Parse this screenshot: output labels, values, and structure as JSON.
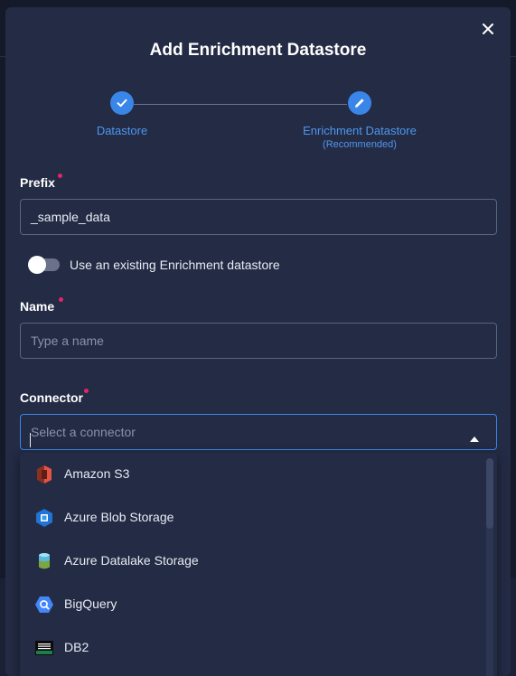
{
  "modal": {
    "title": "Add Enrichment Datastore",
    "close_icon": "close-icon"
  },
  "stepper": {
    "steps": [
      {
        "label": "Datastore",
        "sublabel": "",
        "icon": "check-icon",
        "state": "completed"
      },
      {
        "label": "Enrichment Datastore",
        "sublabel": "(Recommended)",
        "icon": "pencil-icon",
        "state": "active"
      }
    ]
  },
  "form": {
    "prefix": {
      "label": "Prefix",
      "required": true,
      "value": "_sample_data"
    },
    "toggle": {
      "label": "Use an existing Enrichment datastore",
      "checked": false
    },
    "name": {
      "label": "Name",
      "required": true,
      "value": "",
      "placeholder": "Type a name"
    },
    "connector": {
      "label": "Connector",
      "required": true,
      "value": "",
      "placeholder": "Select a connector"
    }
  },
  "connector_options": [
    {
      "label": "Amazon S3",
      "icon": "amazon-s3-icon"
    },
    {
      "label": "Azure Blob Storage",
      "icon": "azure-blob-storage-icon"
    },
    {
      "label": "Azure Datalake Storage",
      "icon": "azure-datalake-storage-icon"
    },
    {
      "label": "BigQuery",
      "icon": "bigquery-icon"
    },
    {
      "label": "DB2",
      "icon": "db2-icon"
    }
  ],
  "colors": {
    "accent": "#3a86e8",
    "required": "#e2266b",
    "modal_bg": "#232b45",
    "page_bg": "#151a2a"
  }
}
